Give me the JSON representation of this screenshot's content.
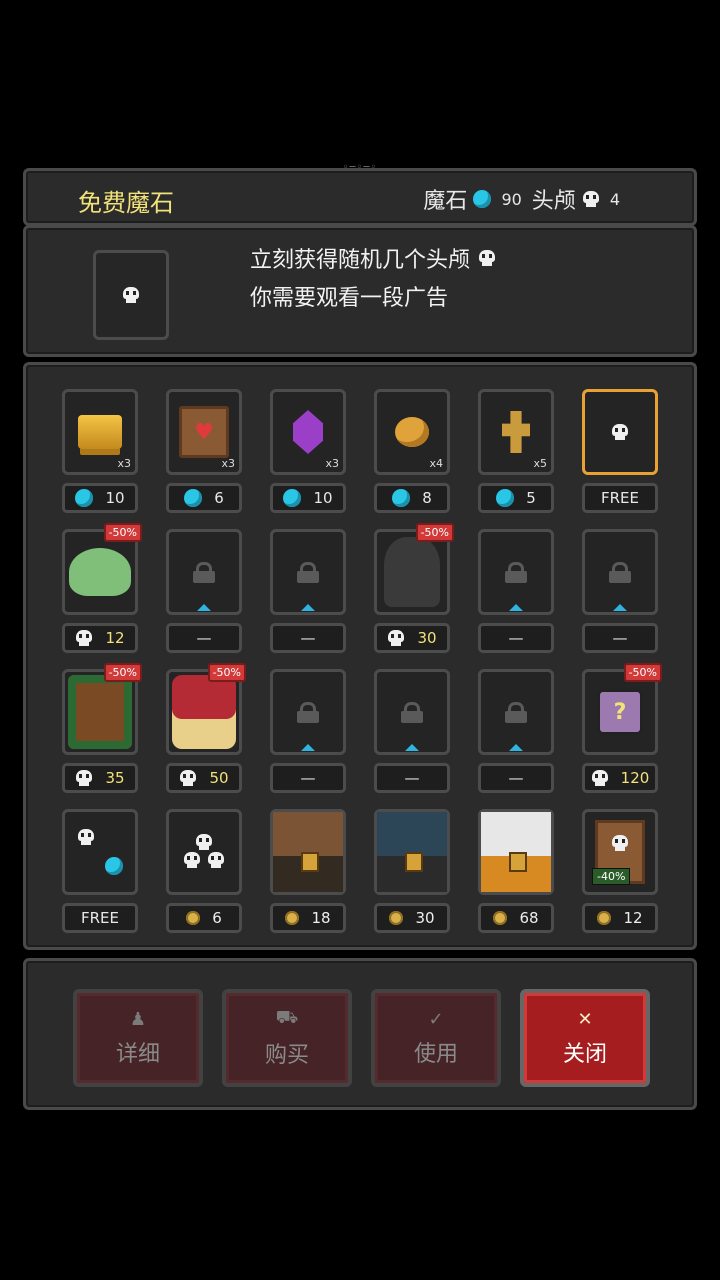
{
  "header": {
    "title": "免费魔石",
    "gem_label": "魔石",
    "gem_count": "90",
    "skull_label": "头颅",
    "skull_count": "4"
  },
  "info": {
    "line1": "立刻获得随机几个头颅",
    "line2": "你需要观看一段广告"
  },
  "shop": {
    "rows": [
      [
        {
          "icon": "gold-bars-icon",
          "qty": "x3",
          "price": "10",
          "currency": "gem"
        },
        {
          "icon": "heart-scroll-icon",
          "qty": "x3",
          "price": "6",
          "currency": "gem"
        },
        {
          "icon": "purple-crystal-icon",
          "qty": "x3",
          "price": "10",
          "currency": "gem"
        },
        {
          "icon": "golden-apple-icon",
          "qty": "x4",
          "price": "8",
          "currency": "gem"
        },
        {
          "icon": "golden-key-icon",
          "qty": "x5",
          "price": "5",
          "currency": "gem"
        },
        {
          "icon": "skull-icon",
          "qty": "",
          "price": "FREE",
          "currency": "none",
          "selected": true
        }
      ],
      [
        {
          "icon": "slime-icon",
          "discount": "-50%",
          "price": "12",
          "currency": "skull"
        },
        {
          "icon": "lock-icon",
          "price": "—",
          "currency": "none",
          "locked": true
        },
        {
          "icon": "lock-icon",
          "price": "—",
          "currency": "none",
          "locked": true
        },
        {
          "icon": "reaper-icon",
          "discount": "-50%",
          "price": "30",
          "currency": "skull"
        },
        {
          "icon": "lock-icon",
          "price": "—",
          "currency": "none",
          "locked": true
        },
        {
          "icon": "lock-icon",
          "price": "—",
          "currency": "none",
          "locked": true
        }
      ],
      [
        {
          "icon": "treant-icon",
          "discount": "-50%",
          "price": "35",
          "currency": "skull"
        },
        {
          "icon": "vampire-girl-icon",
          "discount": "-50%",
          "price": "50",
          "currency": "skull"
        },
        {
          "icon": "lock-icon",
          "price": "—",
          "currency": "none",
          "locked": true
        },
        {
          "icon": "lock-icon",
          "price": "—",
          "currency": "none",
          "locked": true
        },
        {
          "icon": "lock-icon",
          "price": "—",
          "currency": "none",
          "locked": true
        },
        {
          "icon": "mystery-box-icon",
          "discount": "-50%",
          "price": "120",
          "currency": "skull"
        }
      ],
      [
        {
          "icon": "skull-to-gem-icon",
          "price": "FREE",
          "currency": "none"
        },
        {
          "icon": "three-skulls-icon",
          "price": "6",
          "currency": "gold"
        },
        {
          "icon": "brown-chest-icon",
          "price": "18",
          "currency": "gold"
        },
        {
          "icon": "blue-chest-icon",
          "price": "30",
          "currency": "gold"
        },
        {
          "icon": "gold-chest-icon",
          "price": "68",
          "currency": "gold"
        },
        {
          "icon": "skull-note-icon",
          "note": "-40%",
          "price": "12",
          "currency": "gold"
        }
      ]
    ]
  },
  "actions": {
    "details": "详细",
    "buy": "购买",
    "use": "使用",
    "close": "关闭"
  }
}
